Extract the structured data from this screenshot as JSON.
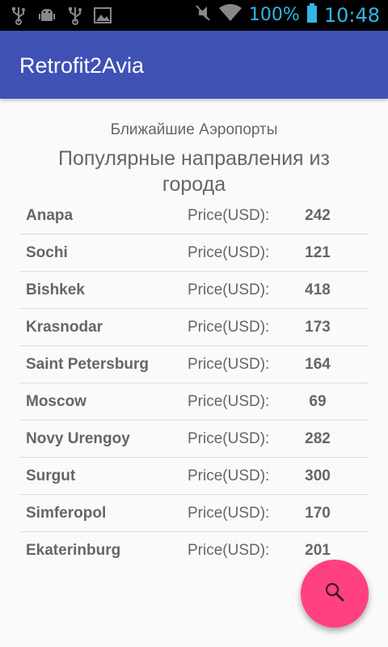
{
  "status_bar": {
    "battery": "100%",
    "time": "10:48",
    "icons": [
      "usb-icon",
      "android-debug-icon",
      "usb-icon",
      "image-icon",
      "mute-icon",
      "wifi-icon",
      "battery-icon"
    ]
  },
  "app_bar": {
    "title": "Retrofit2Avia"
  },
  "main": {
    "subtitle": "Ближайшие Аэропорты",
    "heading": "Популярные направления из города",
    "price_label": "Price(USD):",
    "destinations": [
      {
        "city": "Anapa",
        "price": "242"
      },
      {
        "city": "Sochi",
        "price": "121"
      },
      {
        "city": "Bishkek",
        "price": "418"
      },
      {
        "city": "Krasnodar",
        "price": "173"
      },
      {
        "city": "Saint Petersburg",
        "price": "164"
      },
      {
        "city": "Moscow",
        "price": "69"
      },
      {
        "city": "Novy Urengoy",
        "price": "282"
      },
      {
        "city": "Surgut",
        "price": "300"
      },
      {
        "city": "Simferopol",
        "price": "170"
      },
      {
        "city": "Ekaterinburg",
        "price": "201"
      }
    ]
  },
  "fab": {
    "icon": "search-icon",
    "color": "#ff4081"
  },
  "colors": {
    "app_bar": "#3f51b5",
    "status_text": "#33b5e5"
  }
}
